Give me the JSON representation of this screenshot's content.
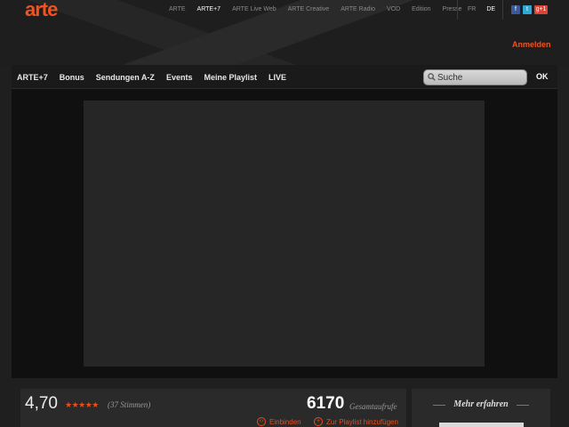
{
  "brand": {
    "logo": "arte"
  },
  "topnav": {
    "links": [
      "ARTE",
      "ARTE+7",
      "ARTE Live Web",
      "ARTE Creative",
      "ARTE Radio",
      "VOD",
      "Edition",
      "Presse"
    ],
    "active": "ARTE+7",
    "languages": [
      "FR",
      "DE"
    ],
    "active_language": "DE",
    "social": [
      "f",
      "t",
      "g+1"
    ]
  },
  "account": {
    "login_label": "Anmelden"
  },
  "mainnav": {
    "items": [
      "ARTE+7",
      "Bonus",
      "Sendungen A-Z",
      "Events",
      "Meine Playlist",
      "LIVE"
    ],
    "search_placeholder": "Suche",
    "search_button": "OK"
  },
  "info": {
    "rating": "4,70",
    "stars": "★★★★★",
    "votes": "(37 Stimmen)",
    "views": "6170",
    "views_label": "Gesamtaufrufe",
    "embed_label": "Einbinden",
    "playlist_label": "Zur Playlist hinzufügen"
  },
  "sidebar": {
    "title": "Mehr erfahren"
  },
  "colors": {
    "accent": "#f3511e",
    "background": "#1f1f1f"
  }
}
